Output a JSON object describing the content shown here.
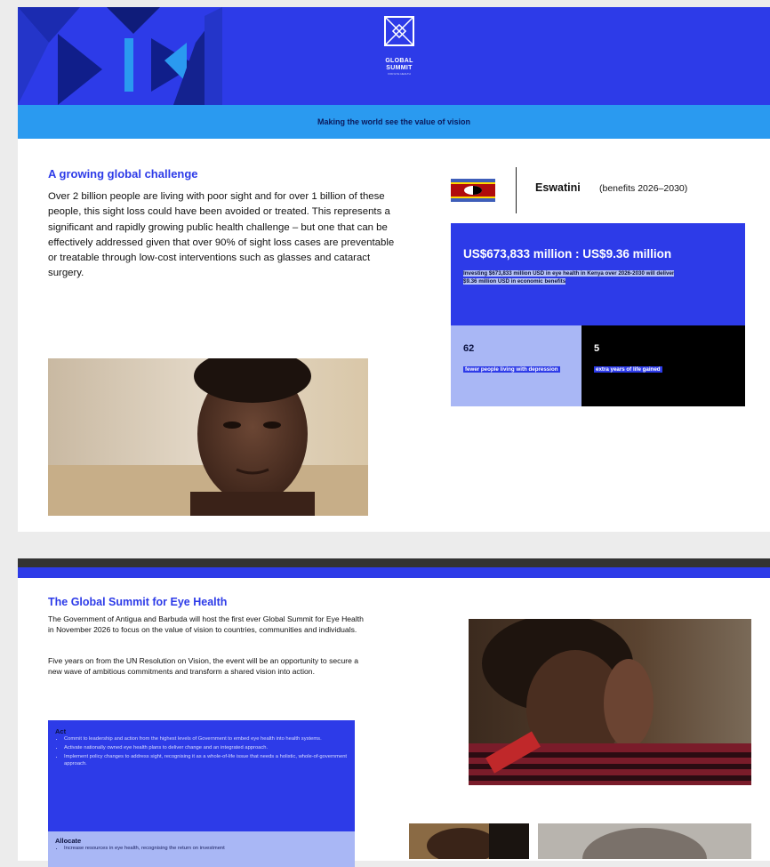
{
  "header": {
    "logo_line1": "GLOBAL",
    "logo_line2": "SUMMIT",
    "logo_line3": "FOR EYE HEALTH",
    "tagline": "Making the world see the value of vision"
  },
  "challenge": {
    "title": "A growing global challenge",
    "body": "Over 2 billion people are living with poor sight and for over 1 billion of these people, this sight loss could have been avoided or treated. This represents a significant and rapidly growing public health challenge – but one that can be effectively addressed given that over 90% of sight loss cases are preventable or treatable through low-cost interventions such as glasses and cataract surgery."
  },
  "country": {
    "flag_icon": "eswatini-flag-icon",
    "name": "Eswatini",
    "period": "(benefits 2026–2030)",
    "main_value": "US$673,833 million : US$9.36 million",
    "main_desc": "Investing $673,833 million USD in eye health in Kenya over 2026-2030 will deliver $9.36 million USD in economic benefits",
    "stat1_value": "62",
    "stat1_label": "fewer people living with depression",
    "stat2_value": "5",
    "stat2_label": "extra years of life gained"
  },
  "summit": {
    "title": "The Global Summit for Eye Health",
    "p1": "The Government of Antigua and Barbuda will host the first ever Global Summit for Eye Health in November 2026 to focus on the value of vision to countries, communities and individuals.",
    "p2": "Five years on from the UN Resolution on Vision, the event will be an opportunity to secure a new wave of ambitious commitments and transform a shared vision into action.",
    "act_title": "Act",
    "act_items": [
      "Commit to leadership and action from the highest levels of Government to embed eye health into health systems.",
      "Activate nationally owned eye health plans to deliver change and an integrated approach.",
      "Implement policy changes to address sight, recognising it as a whole-of-life issue that needs a holistic, whole-of-government approach."
    ],
    "allocate_title": "Allocate",
    "allocate_items": [
      "Increase resources in eye health, recognising the return on investment"
    ]
  },
  "colors": {
    "brand_blue": "#2d3be8",
    "light_blue": "#2a9af0",
    "lavender": "#a9b7f5"
  }
}
